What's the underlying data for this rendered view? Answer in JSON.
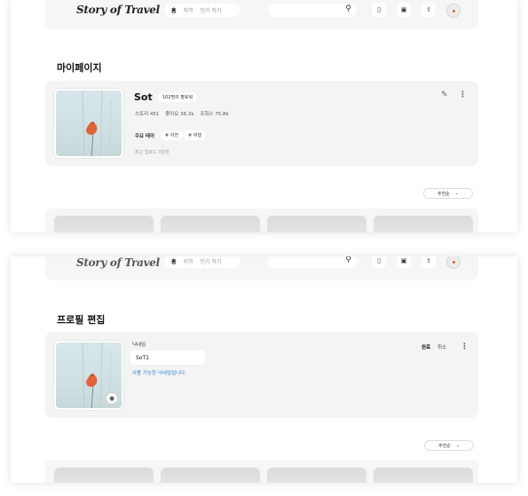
{
  "header": {
    "logo": "Story of Travel",
    "nav": [
      "홈",
      "지역",
      "인기 작가"
    ],
    "icons": [
      "search-icon",
      "bookmark-icon",
      "gallery-icon",
      "upload-icon"
    ]
  },
  "mypage": {
    "title": "마이페이지",
    "name": "Sot",
    "follower_badge": "102명의 팔로워",
    "stats": [
      "스토리 451",
      "좋아요 36.2k",
      "조회수 75.8k"
    ],
    "theme_label": "주요 테마",
    "tags": [
      "# 자연",
      "# 여행"
    ],
    "recent": "최근 업로드 3일전",
    "sort": "추천순"
  },
  "edit": {
    "title": "프로필 편집",
    "nickname_label": "닉네임",
    "nickname_value": "SoT1",
    "hint": "사용 가능한 닉네임입니다.",
    "save_label": "완료",
    "cancel_label": "취소",
    "sort": "추천순"
  },
  "colors": {
    "accent": "#2a7fd1",
    "panel": "#f4f4f4",
    "flower": "#e0643a"
  }
}
